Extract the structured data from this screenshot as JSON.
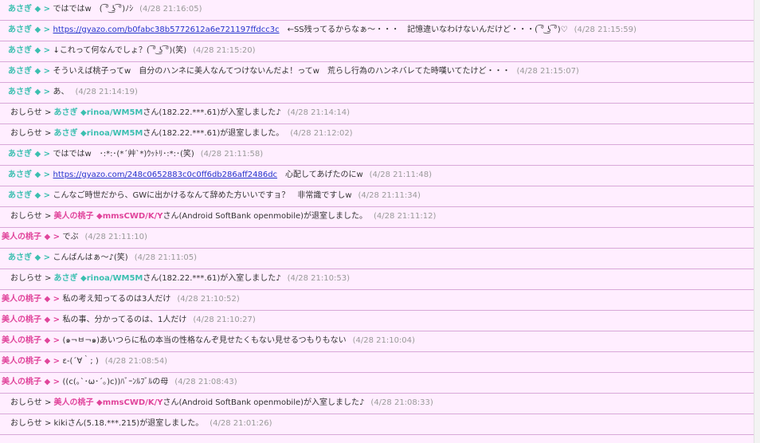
{
  "rows": [
    {
      "kind": "chat",
      "spk": "あさぎ",
      "sc": "c",
      "ind": true,
      "mark": " ◆ > ",
      "pre": "ではではw　( ͡° ͜ʖ ͡°)ﾉｼ",
      "time": "(4/28 21:16:05)"
    },
    {
      "kind": "chat",
      "spk": "あさぎ",
      "sc": "c",
      "ind": true,
      "mark": " ◆ > ",
      "link": "https://gyazo.com/b0fabc38b5772612a6e721197ffdcc3c",
      "post": "　←SS残ってるからなぁ～・・・　記憶違いなわけないんだけど・・・( ͡° ͜ʖ ͡°)♡",
      "time": "(4/28 21:15:59)"
    },
    {
      "kind": "chat",
      "spk": "あさぎ",
      "sc": "c",
      "ind": true,
      "mark": " ◆ > ",
      "pre": "↓これって何なんでしょ？( ͡° ͜ʖ ͡°)(笑)",
      "time": "(4/28 21:15:20)"
    },
    {
      "kind": "chat",
      "spk": "あさぎ",
      "sc": "c",
      "ind": true,
      "mark": " ◆ > ",
      "pre": "そういえば桃子ってw　自分のハンネに美人なんてつけないんだよ！ってw　荒らし行為のハンネバレてた時嘆いてたけど・・・",
      "time": "(4/28 21:15:07)"
    },
    {
      "kind": "chat",
      "spk": "あさぎ",
      "sc": "c",
      "ind": true,
      "mark": " ◆ > ",
      "pre": "あ、",
      "time": "(4/28 21:14:19)"
    },
    {
      "kind": "notice",
      "pre": "おしらせ > ",
      "nick": "あさぎ ◆rinoa/WM5M",
      "nc": "c",
      "post": "さん(182.22.***.61)が入室しました♪",
      "time": "(4/28 21:14:14)"
    },
    {
      "kind": "notice",
      "pre": "おしらせ > ",
      "nick": "あさぎ ◆rinoa/WM5M",
      "nc": "c",
      "post": "さん(182.22.***.61)が退室しました。",
      "time": "(4/28 21:12:02)"
    },
    {
      "kind": "chat",
      "spk": "あさぎ",
      "sc": "c",
      "ind": true,
      "mark": " ◆ > ",
      "pre": "ではではw　･:*:･(*´艸`*)ｳｯﾄﾘ･:*:･(笑)",
      "time": "(4/28 21:11:58)"
    },
    {
      "kind": "chat",
      "spk": "あさぎ",
      "sc": "c",
      "ind": true,
      "mark": " ◆ > ",
      "link": "https://gyazo.com/248c0652883c0c0ff6db286aff2486dc",
      "post": "　心配してあげたのにw",
      "time": "(4/28 21:11:48)"
    },
    {
      "kind": "chat",
      "spk": "あさぎ",
      "sc": "c",
      "ind": true,
      "mark": " ◆ > ",
      "pre": "こんなご時世だから、GWに出かけるなんて辞めた方いいですョ？　非常識ですしw",
      "time": "(4/28 21:11:34)"
    },
    {
      "kind": "notice",
      "pre": "おしらせ > ",
      "nick": "美人の桃子 ◆mmsCWD/K/Y",
      "nc": "m",
      "post": "さん(Android SoftBank openmobile)が退室しました。",
      "time": "(4/28 21:11:12)"
    },
    {
      "kind": "chat",
      "spk": "美人の桃子",
      "sc": "m",
      "ind": false,
      "mark": " ◆ > ",
      "pre": "でぶ",
      "time": "(4/28 21:11:10)"
    },
    {
      "kind": "chat",
      "spk": "あさぎ",
      "sc": "c",
      "ind": true,
      "mark": " ◆ > ",
      "pre": "こんばんはぁ～♪(笑)",
      "time": "(4/28 21:11:05)"
    },
    {
      "kind": "notice",
      "pre": "おしらせ > ",
      "nick": "あさぎ ◆rinoa/WM5M",
      "nc": "c",
      "post": "さん(182.22.***.61)が入室しました♪",
      "time": "(4/28 21:10:53)"
    },
    {
      "kind": "chat",
      "spk": "美人の桃子",
      "sc": "m",
      "ind": false,
      "mark": " ◆ > ",
      "pre": "私の考え知ってるのは3人だけ",
      "time": "(4/28 21:10:52)"
    },
    {
      "kind": "chat",
      "spk": "美人の桃子",
      "sc": "m",
      "ind": false,
      "mark": " ◆ > ",
      "pre": "私の事、分かってるのは、1人だけ",
      "time": "(4/28 21:10:27)"
    },
    {
      "kind": "chat",
      "spk": "美人の桃子",
      "sc": "m",
      "ind": false,
      "mark": " ◆ > ",
      "pre": "(๑¬ㅂ¬๑)あいつらに私の本当の性格なんぞ見せたくもない見せるつもりもない",
      "time": "(4/28 21:10:04)"
    },
    {
      "kind": "chat",
      "spk": "美人の桃子",
      "sc": "m",
      "ind": false,
      "mark": " ◆ > ",
      "pre": "ε-(´∀｀; )",
      "time": "(4/28 21:08:54)"
    },
    {
      "kind": "chat",
      "spk": "美人の桃子",
      "sc": "m",
      "ind": false,
      "mark": " ◆ > ",
      "pre": "((c(｡`･ω･´｡)c))ﾊﾞｰﾝﾙﾌﾞﾙの母",
      "time": "(4/28 21:08:43)"
    },
    {
      "kind": "notice",
      "pre": "おしらせ > ",
      "nick": "美人の桃子 ◆mmsCWD/K/Y",
      "nc": "m",
      "post": "さん(Android SoftBank openmobile)が入室しました♪",
      "time": "(4/28 21:08:33)"
    },
    {
      "kind": "notice",
      "pre": "おしらせ > ",
      "nick": "kiki",
      "nc": "plain",
      "post": "さん(5.18.***.215)が退室しました。",
      "time": "(4/28 21:01:26)"
    }
  ]
}
